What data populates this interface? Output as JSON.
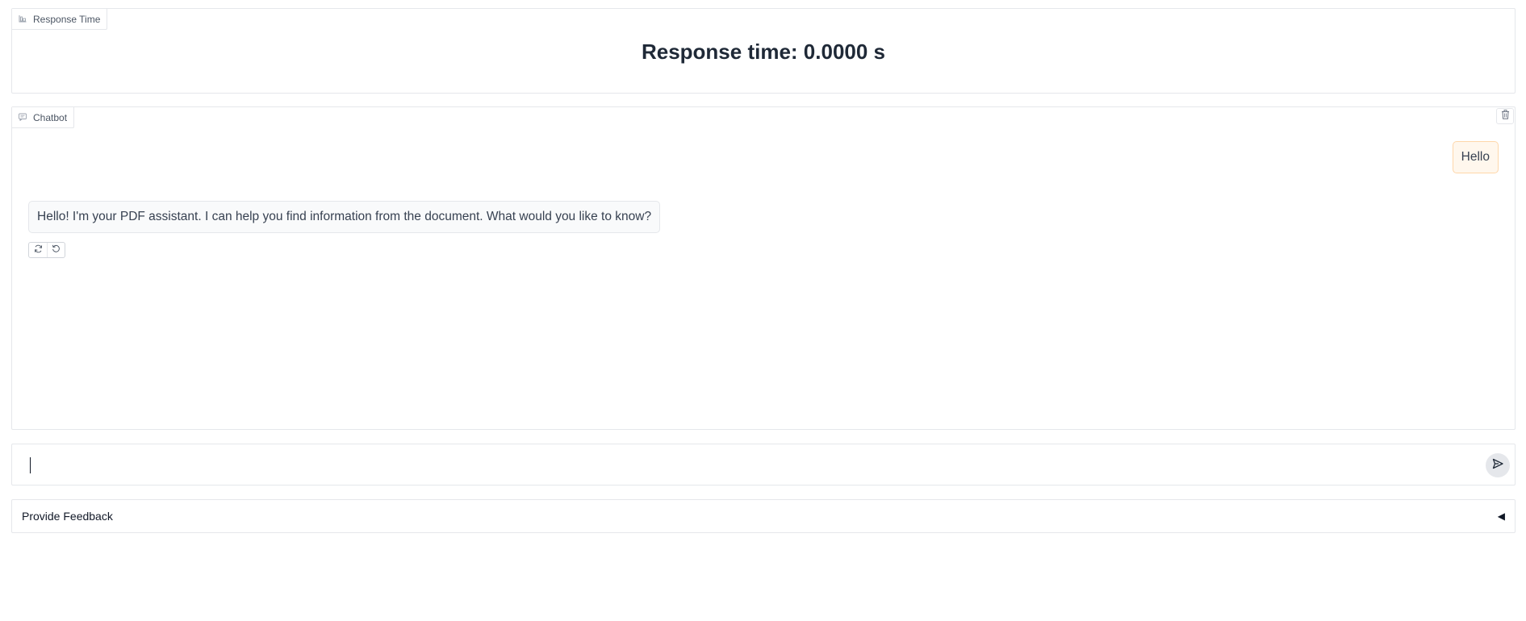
{
  "response_time": {
    "block_label": "Response Time",
    "text": "Response time: 0.0000 s",
    "icon": "bar-chart-icon"
  },
  "chatbot": {
    "block_label": "Chatbot",
    "icon": "chat-icon",
    "clear_icon": "trash-icon",
    "messages": [
      {
        "role": "user",
        "text": "Hello"
      },
      {
        "role": "bot",
        "text": "Hello! I'm your PDF assistant. I can help you find information from the document. What would you like to know?"
      }
    ],
    "actions": [
      {
        "name": "retry",
        "icon": "refresh-icon"
      },
      {
        "name": "undo",
        "icon": "undo-icon"
      }
    ]
  },
  "input": {
    "value": "",
    "send_icon": "send-icon"
  },
  "feedback": {
    "label": "Provide Feedback",
    "toggle": "◀"
  },
  "colors": {
    "user_bubble_bg": "#fff7ed",
    "user_bubble_border": "#fed7aa",
    "bot_bubble_bg": "#f9fafb",
    "border": "#e5e7eb"
  }
}
